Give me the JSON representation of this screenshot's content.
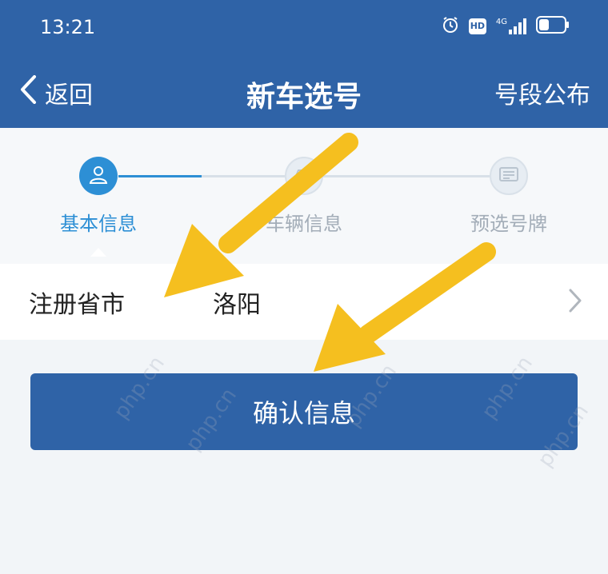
{
  "status_bar": {
    "time": "13:21",
    "icons": [
      "alarm-icon",
      "hd-icon",
      "signal-4g-icon",
      "battery-icon"
    ],
    "hd_label": "HD",
    "network_label": "4G"
  },
  "nav": {
    "back_label": "返回",
    "title": "新车选号",
    "right_label": "号段公布"
  },
  "steps": [
    {
      "label": "基本信息",
      "icon": "person-icon",
      "active": true
    },
    {
      "label": "车辆信息",
      "icon": "car-icon",
      "active": false
    },
    {
      "label": "预选号牌",
      "icon": "plate-icon",
      "active": false
    }
  ],
  "form": {
    "label": "注册省市",
    "value": "洛阳"
  },
  "confirm_label": "确认信息",
  "colors": {
    "brand": "#2f63a7",
    "accent": "#2d8fd5",
    "arrow": "#f5bf1f"
  }
}
